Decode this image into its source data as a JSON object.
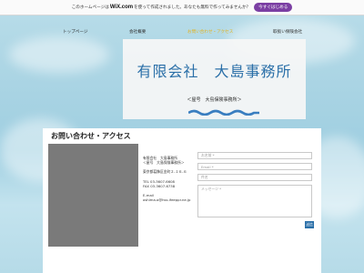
{
  "wix_banner": {
    "text_before": "このホームページは",
    "logo": "WiX.com",
    "text_after": "を使って作成されました。あなたも無料で作ってみませんか？",
    "cta_label": "今すぐはじめる"
  },
  "nav": {
    "items": [
      {
        "label": "トップページ",
        "active": false
      },
      {
        "label": "会社概要",
        "active": false
      },
      {
        "label": "お問い合わせ・アクセス",
        "active": true
      },
      {
        "label": "取扱い保険会社",
        "active": false
      }
    ]
  },
  "header": {
    "company_name": "有限会社　大島事務所",
    "subtitle": "＜屋号　大島保険事務所＞"
  },
  "contact": {
    "title": "お問い合わせ・アクセス",
    "info": {
      "company": "有限会社　大島事務所",
      "tradename": "＜屋号　大島保険事務所＞",
      "address": "東京都葛飾区金町２-１６-６",
      "tel": "TEL  03-3607-6608",
      "fax": "FAX  03-3607-6738",
      "email_label": "E-mail",
      "email": "oshima.o@hss.ifeeppr.ne.jp"
    },
    "form": {
      "name_placeholder": "お名前 *",
      "email_placeholder": "Email *",
      "subject_placeholder": "件名",
      "message_placeholder": "メッセージ *",
      "submit_label": "送信"
    }
  },
  "colors": {
    "accent": "#2a6fa8",
    "nav_active": "#e3b21c",
    "wix_cta": "#7b3fa3"
  }
}
